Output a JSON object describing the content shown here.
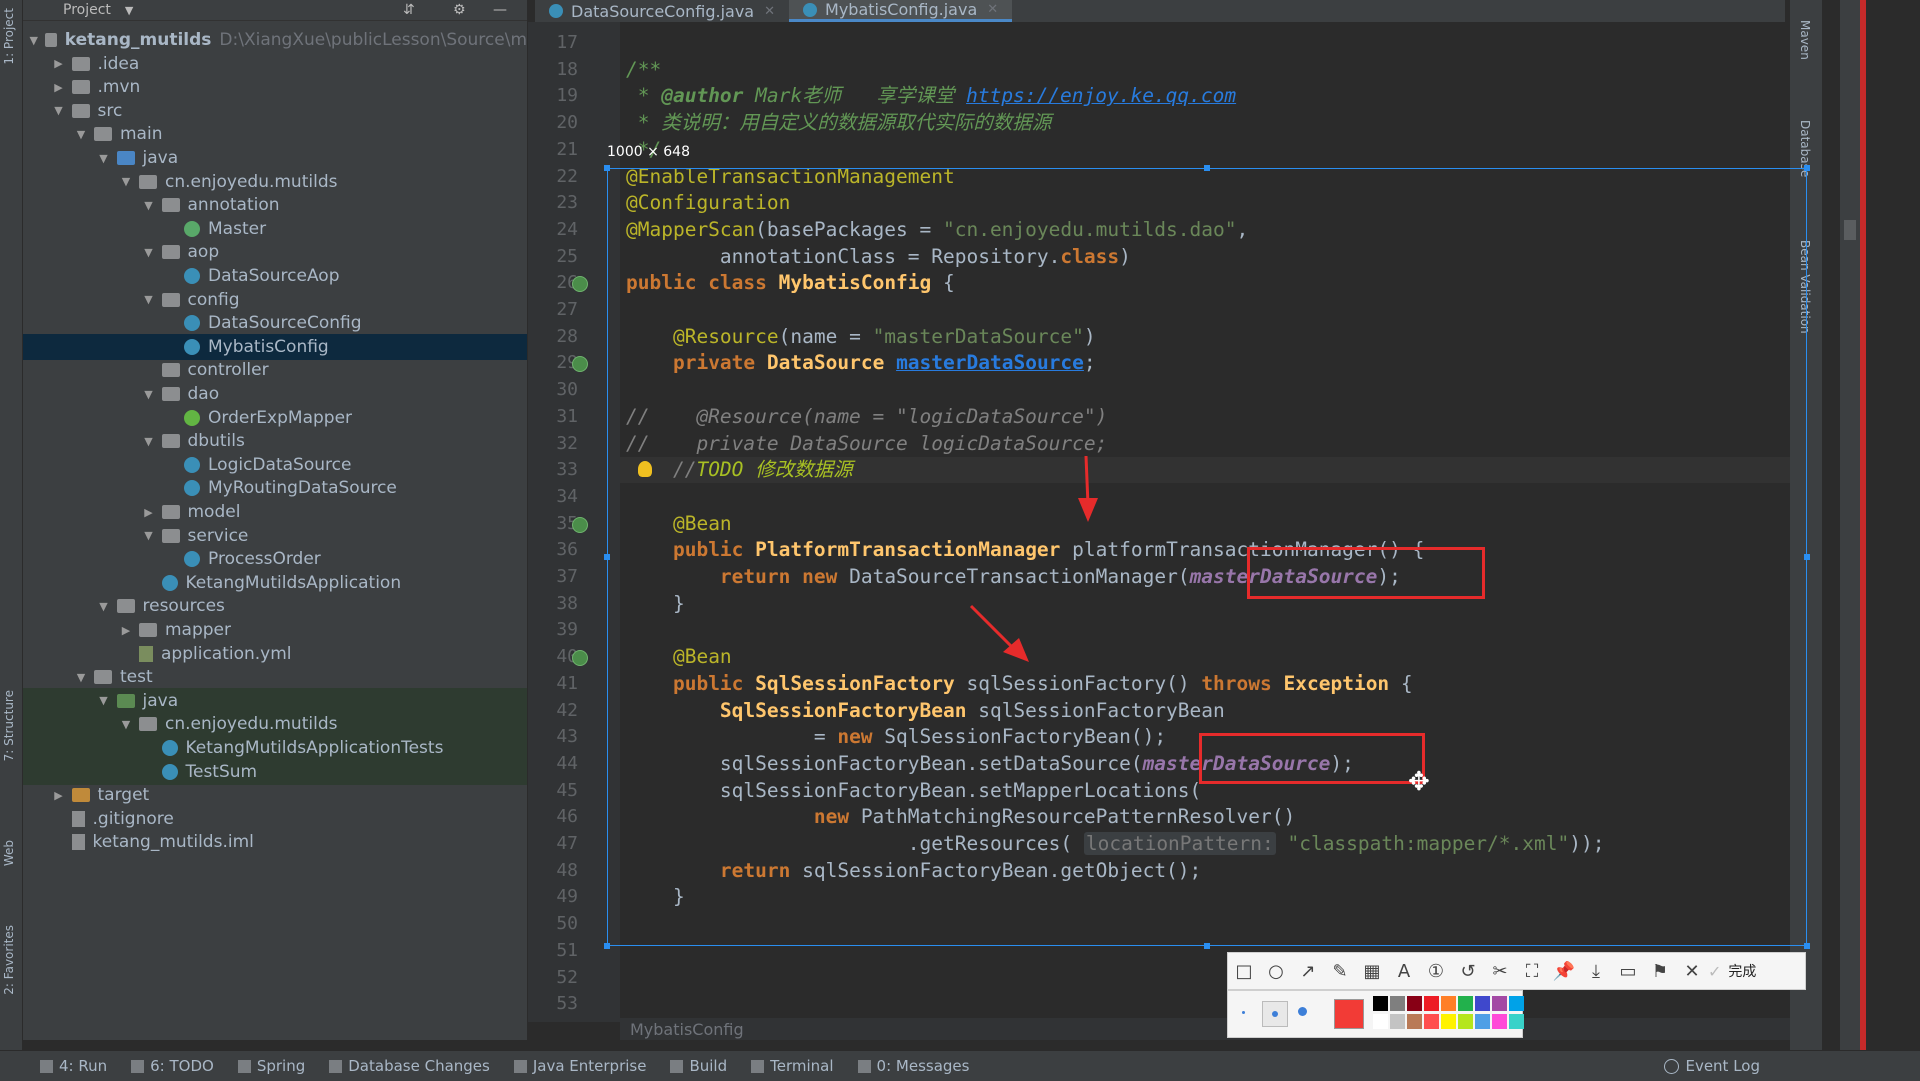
{
  "left_strip": {
    "project": "1: Project",
    "structure": "7: Structure",
    "web": "Web",
    "favorites": "2: Favorites"
  },
  "project_panel": {
    "title": "Project",
    "tree": [
      {
        "label": "ketang_mutilds",
        "extra": "D:\\XiangXue\\publicLesson\\Source\\m",
        "depth": 0,
        "arrow": "down",
        "icon": "folder"
      },
      {
        "label": ".idea",
        "depth": 1,
        "arrow": "right",
        "icon": "folder"
      },
      {
        "label": ".mvn",
        "depth": 1,
        "arrow": "right",
        "icon": "folder"
      },
      {
        "label": "src",
        "depth": 1,
        "arrow": "down",
        "icon": "folder"
      },
      {
        "label": "main",
        "depth": 2,
        "arrow": "down",
        "icon": "folder"
      },
      {
        "label": "java",
        "depth": 3,
        "arrow": "down",
        "icon": "folder-blue"
      },
      {
        "label": "cn.enjoyedu.mutilds",
        "depth": 4,
        "arrow": "down",
        "icon": "folder"
      },
      {
        "label": "annotation",
        "depth": 5,
        "arrow": "down",
        "icon": "folder"
      },
      {
        "label": "Master",
        "depth": 6,
        "arrow": "",
        "icon": "annotation"
      },
      {
        "label": "aop",
        "depth": 5,
        "arrow": "down",
        "icon": "folder"
      },
      {
        "label": "DataSourceAop",
        "depth": 6,
        "arrow": "",
        "icon": "class"
      },
      {
        "label": "config",
        "depth": 5,
        "arrow": "down",
        "icon": "folder"
      },
      {
        "label": "DataSourceConfig",
        "depth": 6,
        "arrow": "",
        "icon": "class"
      },
      {
        "label": "MybatisConfig",
        "depth": 6,
        "arrow": "",
        "icon": "class",
        "selected": true
      },
      {
        "label": "controller",
        "depth": 5,
        "arrow": "",
        "icon": "folder"
      },
      {
        "label": "dao",
        "depth": 5,
        "arrow": "down",
        "icon": "folder"
      },
      {
        "label": "OrderExpMapper",
        "depth": 6,
        "arrow": "",
        "icon": "interface"
      },
      {
        "label": "dbutils",
        "depth": 5,
        "arrow": "down",
        "icon": "folder"
      },
      {
        "label": "LogicDataSource",
        "depth": 6,
        "arrow": "",
        "icon": "class"
      },
      {
        "label": "MyRoutingDataSource",
        "depth": 6,
        "arrow": "",
        "icon": "class"
      },
      {
        "label": "model",
        "depth": 5,
        "arrow": "right",
        "icon": "folder"
      },
      {
        "label": "service",
        "depth": 5,
        "arrow": "down",
        "icon": "folder"
      },
      {
        "label": "ProcessOrder",
        "depth": 6,
        "arrow": "",
        "icon": "class"
      },
      {
        "label": "KetangMutildsApplication",
        "depth": 5,
        "arrow": "",
        "icon": "class"
      },
      {
        "label": "resources",
        "depth": 3,
        "arrow": "down",
        "icon": "folder"
      },
      {
        "label": "mapper",
        "depth": 4,
        "arrow": "right",
        "icon": "folder"
      },
      {
        "label": "application.yml",
        "depth": 4,
        "arrow": "",
        "icon": "yml"
      },
      {
        "label": "test",
        "depth": 2,
        "arrow": "down",
        "icon": "folder"
      },
      {
        "label": "java",
        "depth": 3,
        "arrow": "down",
        "icon": "folder-green",
        "testbg": true
      },
      {
        "label": "cn.enjoyedu.mutilds",
        "depth": 4,
        "arrow": "down",
        "icon": "folder",
        "testbg": true
      },
      {
        "label": "KetangMutildsApplicationTests",
        "depth": 5,
        "arrow": "",
        "icon": "class",
        "testbg": true
      },
      {
        "label": "TestSum",
        "depth": 5,
        "arrow": "",
        "icon": "class",
        "testbg": true
      },
      {
        "label": "target",
        "depth": 1,
        "arrow": "right",
        "icon": "folder-orange"
      },
      {
        "label": ".gitignore",
        "depth": 1,
        "arrow": "",
        "icon": "file"
      },
      {
        "label": "ketang_mutilds.iml",
        "depth": 1,
        "arrow": "",
        "icon": "file"
      }
    ]
  },
  "editor": {
    "tabs": [
      {
        "label": "DataSourceConfig.java",
        "active": false
      },
      {
        "label": "MybatisConfig.java",
        "active": true
      }
    ],
    "first_line": 17,
    "line_count": 37,
    "code_lines": [
      {
        "n": 17,
        "t": ""
      },
      {
        "n": 18,
        "t": "/**"
      },
      {
        "n": 19,
        "t": " * @author Mark老师   享学课堂 https://enjoy.ke.qq.com"
      },
      {
        "n": 20,
        "t": " * 类说明：用自定义的数据源取代实际的数据源"
      },
      {
        "n": 21,
        "t": " */"
      },
      {
        "n": 22,
        "t": "@EnableTransactionManagement"
      },
      {
        "n": 23,
        "t": "@Configuration"
      },
      {
        "n": 24,
        "t": "@MapperScan(basePackages = \"cn.enjoyedu.mutilds.dao\","
      },
      {
        "n": 25,
        "t": "        annotationClass = Repository.class)"
      },
      {
        "n": 26,
        "t": "public class MybatisConfig {"
      },
      {
        "n": 27,
        "t": ""
      },
      {
        "n": 28,
        "t": "    @Resource(name = \"masterDataSource\")"
      },
      {
        "n": 29,
        "t": "    private DataSource masterDataSource;"
      },
      {
        "n": 30,
        "t": ""
      },
      {
        "n": 31,
        "t": "//    @Resource(name = \"logicDataSource\")"
      },
      {
        "n": 32,
        "t": "//    private DataSource logicDataSource;"
      },
      {
        "n": 33,
        "t": "    //TODO 修改数据源"
      },
      {
        "n": 34,
        "t": ""
      },
      {
        "n": 35,
        "t": "    @Bean"
      },
      {
        "n": 36,
        "t": "    public PlatformTransactionManager platformTransactionManager() {"
      },
      {
        "n": 37,
        "t": "        return new DataSourceTransactionManager(masterDataSource);"
      },
      {
        "n": 38,
        "t": "    }"
      },
      {
        "n": 39,
        "t": ""
      },
      {
        "n": 40,
        "t": "    @Bean"
      },
      {
        "n": 41,
        "t": "    public SqlSessionFactory sqlSessionFactory() throws Exception {"
      },
      {
        "n": 42,
        "t": "        SqlSessionFactoryBean sqlSessionFactoryBean"
      },
      {
        "n": 43,
        "t": "                = new SqlSessionFactoryBean();"
      },
      {
        "n": 44,
        "t": "        sqlSessionFactoryBean.setDataSource(masterDataSource);"
      },
      {
        "n": 45,
        "t": "        sqlSessionFactoryBean.setMapperLocations("
      },
      {
        "n": 46,
        "t": "                new PathMatchingResourcePatternResolver()"
      },
      {
        "n": 47,
        "t": "                        .getResources( locationPattern: \"classpath:mapper/*.xml\"));"
      },
      {
        "n": 48,
        "t": "        return sqlSessionFactoryBean.getObject();"
      },
      {
        "n": 49,
        "t": "    }"
      },
      {
        "n": 50,
        "t": ""
      },
      {
        "n": 51,
        "t": ""
      },
      {
        "n": 52,
        "t": ""
      },
      {
        "n": 53,
        "t": ""
      }
    ],
    "breadcrumb": "MybatisConfig"
  },
  "screenshot_overlay": {
    "size_label": "1000 × 648",
    "done_label": "完成",
    "tools": [
      "rectangle-tool",
      "ellipse-tool",
      "arrow-tool",
      "pen-tool",
      "mosaic-tool",
      "text-tool",
      "number-tool",
      "undo-tool",
      "screenshot-tool",
      "fullscreen-tool",
      "pin-tool",
      "download-tool",
      "save-tool",
      "bookmark-tool",
      "close-tool"
    ],
    "selected_color": "#f23b36",
    "palette": [
      "#000000",
      "#7f7f7f",
      "#880015",
      "#ed1c24",
      "#ff7f27",
      "#22b14c",
      "#3f48cc",
      "#a349a4",
      "#00a2e8",
      "#ffffff",
      "#c3c3c3",
      "#b97a57",
      "#ff4f4f",
      "#fff200",
      "#b5e61d",
      "#4e9fe6",
      "#ff4ad8",
      "#39d2c9"
    ]
  },
  "bottom_bar": {
    "items": [
      "4: Run",
      "6: TODO",
      "Spring",
      "Database Changes",
      "Java Enterprise",
      "Build",
      "Terminal",
      "0: Messages"
    ],
    "event_log": "Event Log"
  },
  "right_strip": {
    "maven": "Maven",
    "database": "Database",
    "bean_validation": "Bean Validation"
  },
  "colors": {
    "accent": "#2a8ef0",
    "annotation_red": "#e62b2b",
    "editor_bg": "#2b2b2b",
    "panel_bg": "#3c3f41"
  }
}
